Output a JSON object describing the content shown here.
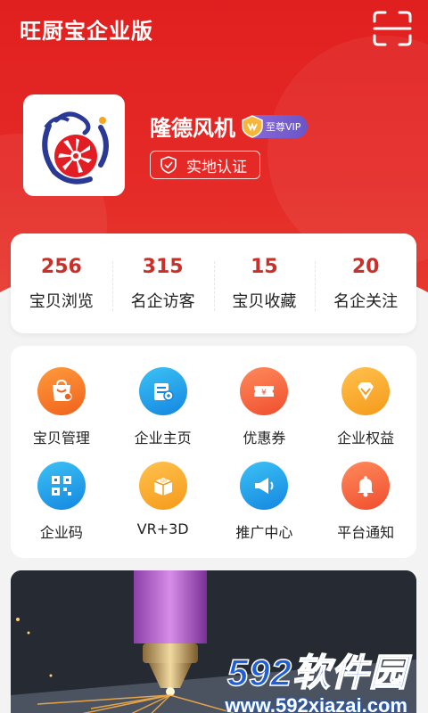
{
  "header": {
    "title": "旺厨宝企业版",
    "scan_icon": "scan-icon",
    "bg_color": "#e0201f"
  },
  "profile": {
    "company_name": "隆德风机",
    "vip_label": "至尊VIP",
    "verify_label": "实地认证"
  },
  "stats": [
    {
      "value": "256",
      "label": "宝贝浏览"
    },
    {
      "value": "315",
      "label": "名企访客"
    },
    {
      "value": "15",
      "label": "宝贝收藏"
    },
    {
      "value": "20",
      "label": "名企关注"
    }
  ],
  "features": [
    {
      "label": "宝贝管理",
      "icon": "bag-icon",
      "color": "#f57a22"
    },
    {
      "label": "企业主页",
      "icon": "homepage-icon",
      "color": "#1d9ae8"
    },
    {
      "label": "优惠券",
      "icon": "coupon-icon",
      "color": "#f4683c"
    },
    {
      "label": "企业权益",
      "icon": "diamond-icon",
      "color": "#f5a623"
    },
    {
      "label": "企业码",
      "icon": "qrcode-icon",
      "color": "#1d9ae8"
    },
    {
      "label": "VR+3D",
      "icon": "vr-icon",
      "color": "#f5a623"
    },
    {
      "label": "推广中心",
      "icon": "megaphone-icon",
      "color": "#1d9ae8"
    },
    {
      "label": "平台通知",
      "icon": "bell-icon",
      "color": "#f4683c"
    }
  ],
  "watermark": {
    "brand": "592软件园",
    "url": "www.592xiazai.com"
  }
}
